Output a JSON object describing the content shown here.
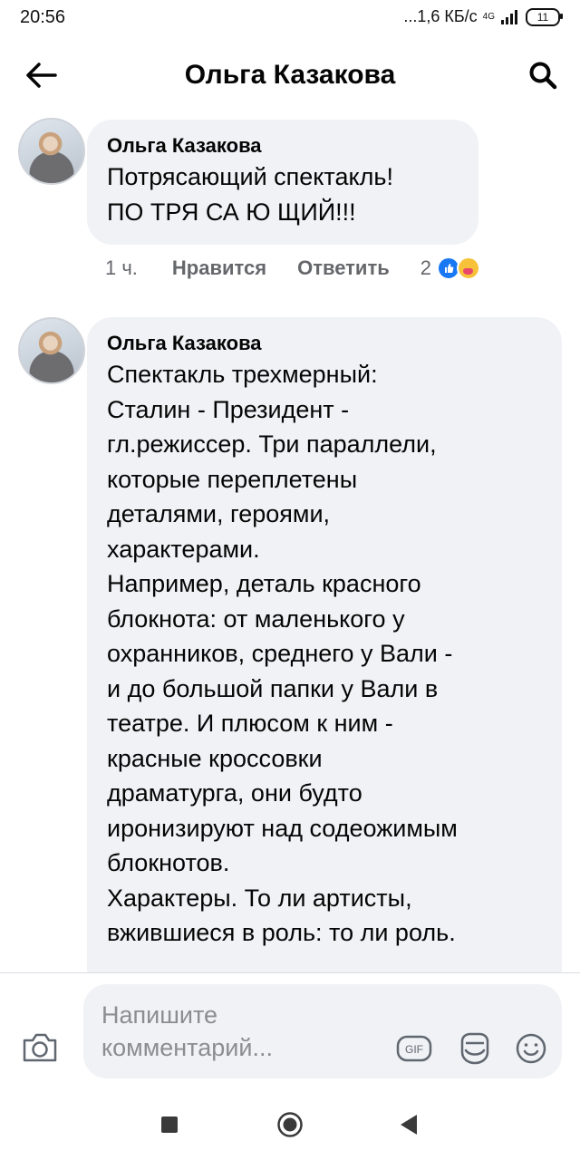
{
  "status_bar": {
    "time": "20:56",
    "speed": "...1,6 КБ/с",
    "network": "4G",
    "battery": "11"
  },
  "header": {
    "title": "Ольга Казакова",
    "back_icon": "arrow-left-icon",
    "search_icon": "search-icon"
  },
  "comments": [
    {
      "author": "Ольга Казакова",
      "text": "Потрясающий спектакль!\nПО ТРЯ СА Ю ЩИЙ!!!",
      "time": "1 ч.",
      "like_label": "Нравится",
      "reply_label": "Ответить",
      "reaction_count": "2",
      "reactions": [
        "like-icon",
        "care-icon"
      ]
    },
    {
      "author": "Ольга Казакова",
      "text": "Спектакль трехмерный:\nСталин - Президент -\nгл.режиссер. Три параллели,\nкоторые переплетены\nдеталями, героями,\nхарактерами.\nНапример, деталь красного\nблокнота: от маленького у\nохранников, среднего у Вали -\nи до большой папки у Вали в\nтеатре. И плюсом к ним -\nкрасные кроссовки\nдраматурга, они будто\nиронизируют над содеожимым\nблокнотов.\nХарактеры. То ли артисты,\nвжившиеся в роль: то ли роль."
    }
  ],
  "composer": {
    "placeholder": "Напишите комментарий...",
    "gif_label": "GIF"
  },
  "colors": {
    "bubble": "#f0f2f5",
    "text": "#050505",
    "meta": "#65676b",
    "like_blue": "#1877f2"
  }
}
